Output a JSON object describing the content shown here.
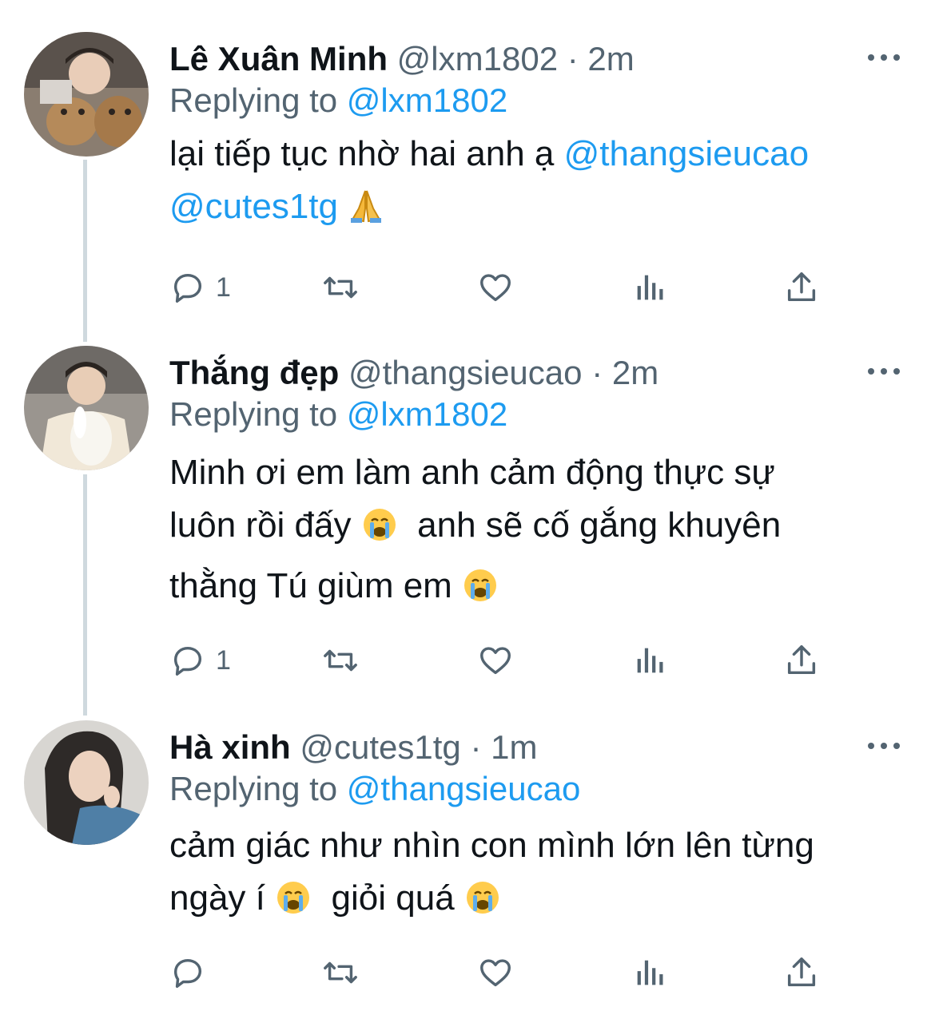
{
  "tweets": [
    {
      "name": "Lê Xuân Minh",
      "handle": "@lxm1802",
      "time": "2m",
      "replying_prefix": "Replying to",
      "replying_to": "@lxm1802",
      "text_lines": [
        {
          "text": "lại tiếp tục nhờ hai anh ạ ",
          "mention": "@thangsieucao"
        },
        {
          "mention": "@cutes1tg",
          "emoji": "folded-hands-emoji"
        }
      ],
      "reply_count": "1",
      "avatar": "avatar-le-xuan-minh"
    },
    {
      "name": "Thắng đẹp",
      "handle": "@thangsieucao",
      "time": "2m",
      "replying_prefix": "Replying to",
      "replying_to": "@lxm1802",
      "text_lines": [
        {
          "text": "Minh ơi em làm anh cảm động thực sự"
        },
        {
          "text": "luôn rồi đấy ",
          "emoji": "loudly-crying-emoji",
          "text2": "  anh sẽ cố gắng khuyên"
        },
        {
          "text": "thằng Tú giùm em ",
          "emoji": "loudly-crying-emoji"
        }
      ],
      "reply_count": "1",
      "avatar": "avatar-thang-dep"
    },
    {
      "name": "Hà xinh",
      "handle": "@cutes1tg",
      "time": "1m",
      "replying_prefix": "Replying to",
      "replying_to": "@thangsieucao",
      "text_lines": [
        {
          "text": "cảm giác như nhìn con mình lớn lên từng"
        },
        {
          "text": "ngày í ",
          "emoji": "loudly-crying-emoji",
          "text2": "  giỏi quá ",
          "emoji2": "loudly-crying-emoji"
        }
      ],
      "reply_count": "",
      "avatar": "avatar-ha-xinh"
    }
  ],
  "separator": "·",
  "icons": [
    "reply-icon",
    "retweet-icon",
    "like-icon",
    "analytics-icon",
    "share-icon",
    "more-icon"
  ],
  "colors": {
    "link": "#1d9bf0",
    "secondary": "#536471",
    "thread_line": "#cfd9de"
  }
}
